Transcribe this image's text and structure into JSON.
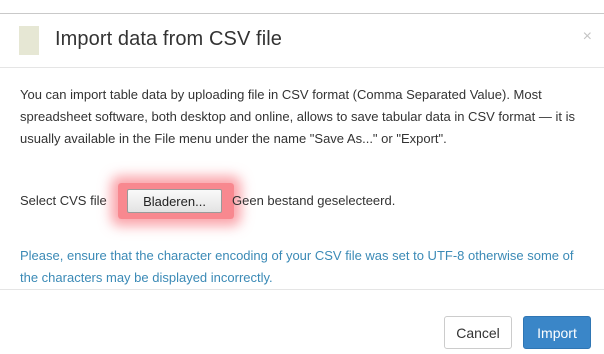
{
  "dialog": {
    "title": "Import data from CSV file",
    "close_label": "×"
  },
  "body": {
    "intro": "You can import table data by uploading file in CSV format (Comma Separated Value). Most spreadsheet software, both desktop and online, allows to save tabular data in CSV format — it is usually available in the File menu under the name \"Save As...\" or \"Export\".",
    "file_label": "Select CVS file",
    "browse_button_label": "Bladeren...",
    "file_status": "Geen bestand geselecteerd.",
    "encoding_note": "Please, ensure that the character encoding of your CSV file was set to UTF-8 otherwise some of the characters may be displayed incorrectly."
  },
  "footer": {
    "cancel_label": "Cancel",
    "import_label": "Import"
  },
  "colors": {
    "primary": "#3a86c8",
    "note_text": "#3b8ab6",
    "highlight": "#f55a64"
  },
  "icons": {
    "close": "close-icon",
    "title_swatch": "color-swatch"
  }
}
